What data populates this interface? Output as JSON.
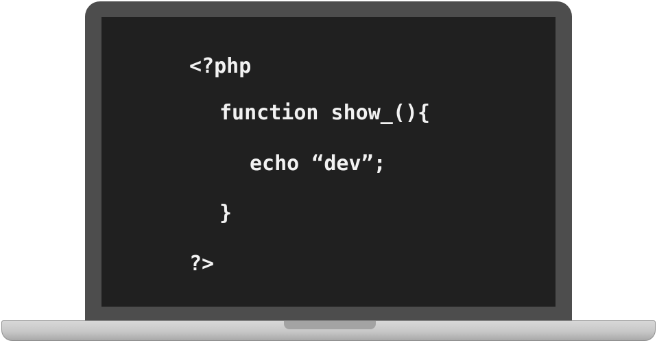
{
  "code": {
    "lines": [
      "<?php",
      "function show_(){",
      "echo “dev”;",
      "}",
      "?>"
    ]
  }
}
